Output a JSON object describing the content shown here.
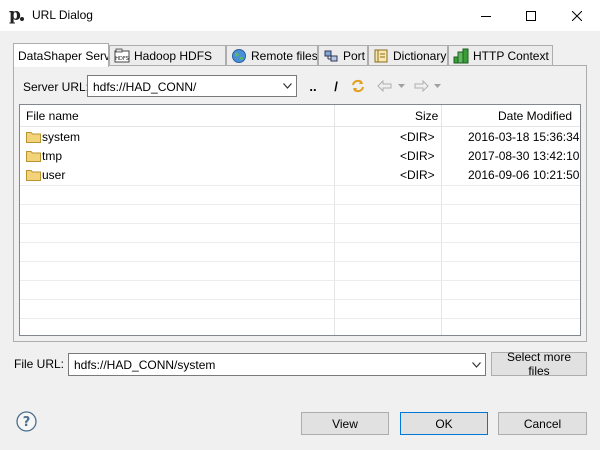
{
  "window": {
    "title": "URL Dialog"
  },
  "tabs": [
    {
      "label": "DataShaper Serv",
      "icon": "none",
      "active": true
    },
    {
      "label": "Hadoop HDFS",
      "icon": "hdfs-icon",
      "active": false
    },
    {
      "label": "Remote files",
      "icon": "globe-icon",
      "active": false
    },
    {
      "label": "Port",
      "icon": "port-icon",
      "active": false
    },
    {
      "label": "Dictionary",
      "icon": "dictionary-icon",
      "active": false
    },
    {
      "label": "HTTP Context",
      "icon": "http-context-icon",
      "active": false
    }
  ],
  "server": {
    "label": "Server URL:",
    "value": "hdfs://HAD_CONN/",
    "parent_label": "..",
    "root_label": "/"
  },
  "table": {
    "columns": {
      "name": "File name",
      "size": "Size",
      "date": "Date Modified"
    },
    "rows": [
      {
        "name": "system",
        "size": "<DIR>",
        "date": "2016-03-18 15:36:34"
      },
      {
        "name": "tmp",
        "size": "<DIR>",
        "date": "2017-08-30 13:42:10"
      },
      {
        "name": "user",
        "size": "<DIR>",
        "date": "2016-09-06 10:21:50"
      }
    ]
  },
  "file_url": {
    "label": "File URL:",
    "value": "hdfs://HAD_CONN/system",
    "select_more_label": "Select more files"
  },
  "buttons": {
    "view": "View",
    "ok": "OK",
    "cancel": "Cancel"
  },
  "colors": {
    "accent": "#0078d7",
    "folder": "#f3d37a"
  }
}
